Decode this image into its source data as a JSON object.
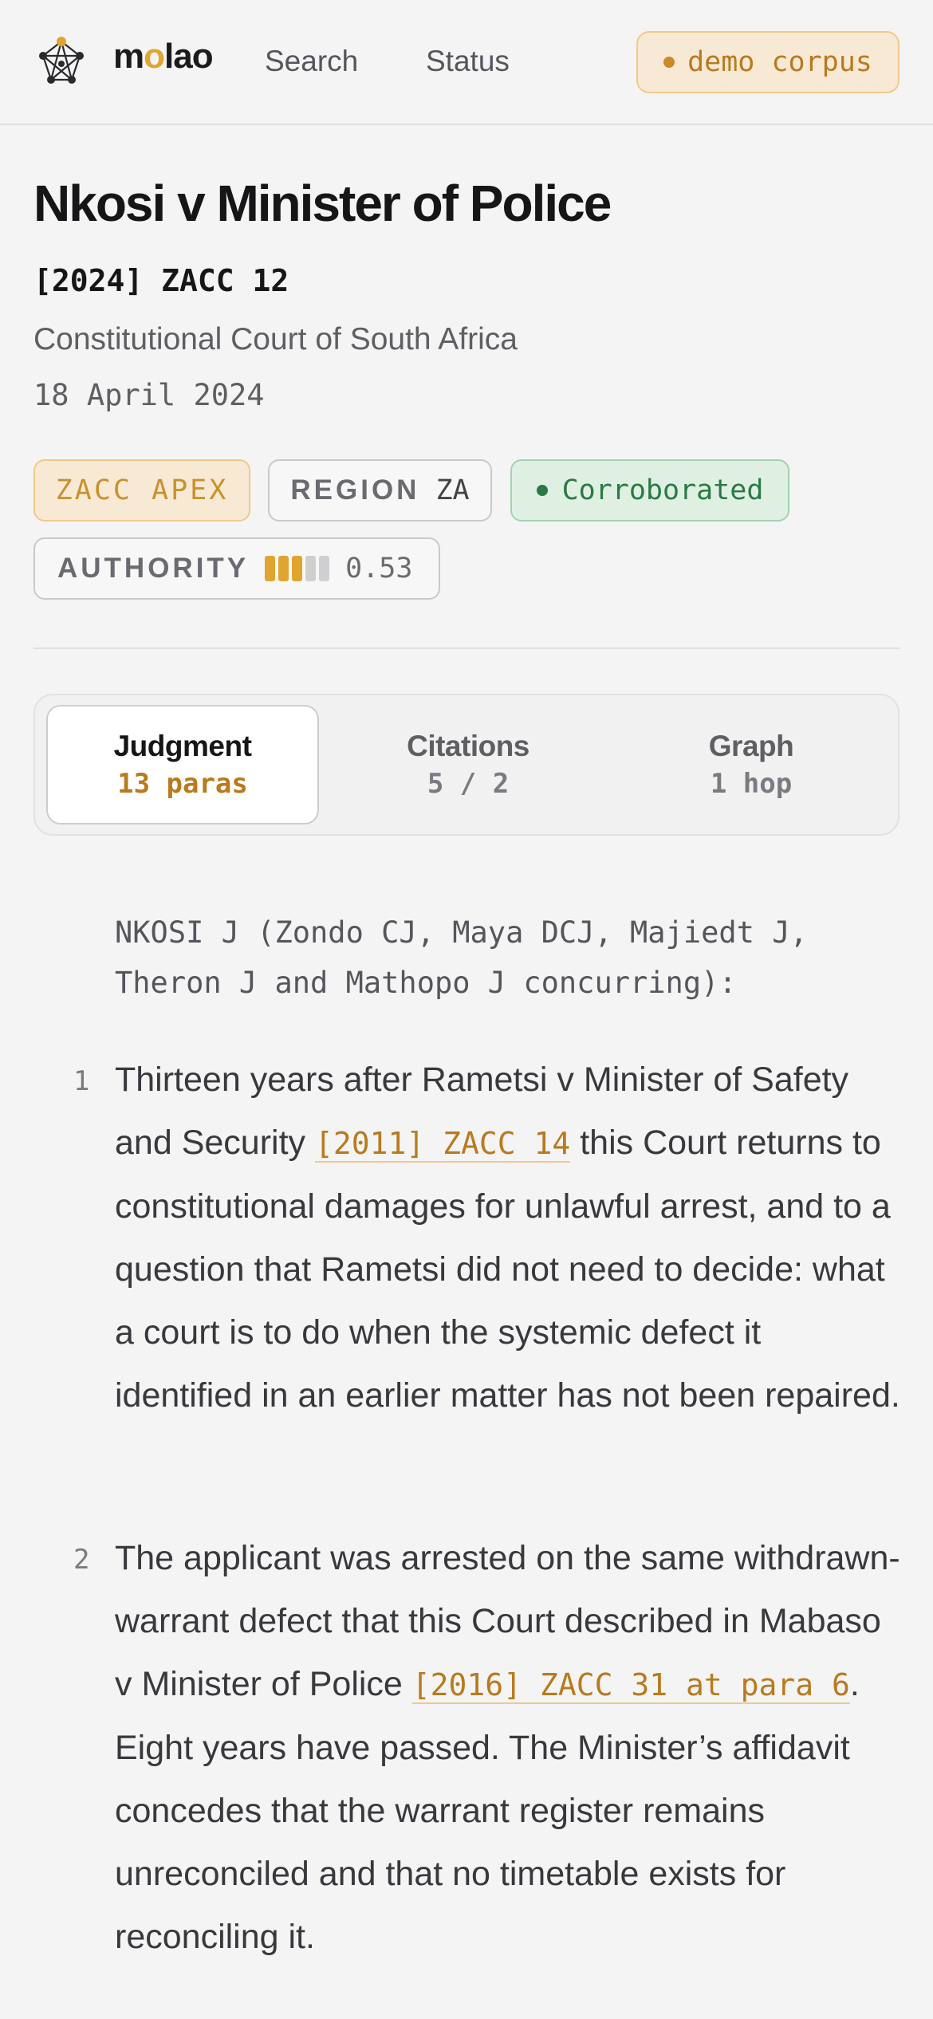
{
  "nav": {
    "logo_pre": "m",
    "logo_o": "o",
    "logo_post": "lao",
    "links": [
      "Search",
      "Status"
    ],
    "corpus_badge": "demo corpus"
  },
  "case": {
    "title": "Nkosi v Minister of Police",
    "citation": "[2024] ZACC 12",
    "court": "Constitutional Court of South Africa",
    "date": "18 April 2024"
  },
  "badges": {
    "apex": "ZACC APEX",
    "region_key": "REGION",
    "region_value": "ZA",
    "status": "Corroborated",
    "authority_key": "AUTHORITY",
    "authority_value": "0.53",
    "authority_bars_filled": 3,
    "authority_bars_total": 5
  },
  "tabs": [
    {
      "label": "Judgment",
      "sub": "13 paras",
      "active": true
    },
    {
      "label": "Citations",
      "sub": "5 / 2",
      "active": false
    },
    {
      "label": "Graph",
      "sub": "1 hop",
      "active": false
    }
  ],
  "judgment": {
    "bench": "NKOSI J (Zondo CJ, Maya DCJ, Majiedt J, Theron J and Mathopo J concurring):",
    "paragraphs": [
      {
        "num": "1",
        "before": "Thirteen years after Rametsi v Minister of Safety and Security ",
        "cite": "[2011] ZACC 14",
        "after": " this Court returns to constitutional damages for unlawful arrest, and to a question that Rametsi did not need to decide: what a court is to do when the systemic defect it identified in an earlier matter has not been repaired."
      },
      {
        "num": "2",
        "before": "The applicant was arrested on the same withdrawn-warrant defect that this Court described in Mabaso v Minister of Police ",
        "cite": "[2016] ZACC 31 at para 6",
        "after": ". Eight years have passed. The Minister’s affidavit concedes that the warrant register remains unreconciled and that no timetable exists for reconciling it."
      }
    ]
  },
  "colors": {
    "accent": "#e0a531",
    "accent_text": "#b97a1e",
    "success": "#2a7a44",
    "background": "#f4f4f4"
  }
}
